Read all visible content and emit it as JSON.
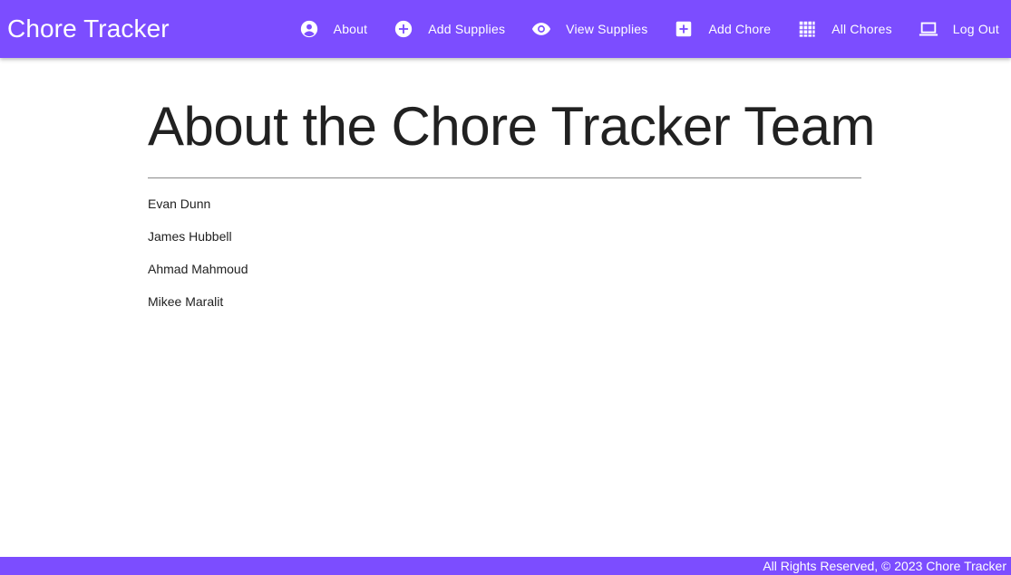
{
  "header": {
    "brand": "Chore Tracker",
    "nav": [
      {
        "label": "About",
        "icon": "account-circle-icon"
      },
      {
        "label": "Add Supplies",
        "icon": "add-circle-icon"
      },
      {
        "label": "View Supplies",
        "icon": "eye-icon"
      },
      {
        "label": "Add Chore",
        "icon": "add-box-icon"
      },
      {
        "label": "All Chores",
        "icon": "apps-grid-icon"
      },
      {
        "label": "Log Out",
        "icon": "laptop-icon"
      }
    ]
  },
  "main": {
    "title": "About the Chore Tracker Team",
    "members": [
      "Evan Dunn",
      "James Hubbell",
      "Ahmad Mahmoud",
      "Mikee Maralit"
    ]
  },
  "footer": {
    "text": "All Rights Reserved, © 2023 Chore Tracker"
  },
  "colors": {
    "primary": "#7c4dff",
    "text": "#212121",
    "on_primary": "#ffffff"
  }
}
